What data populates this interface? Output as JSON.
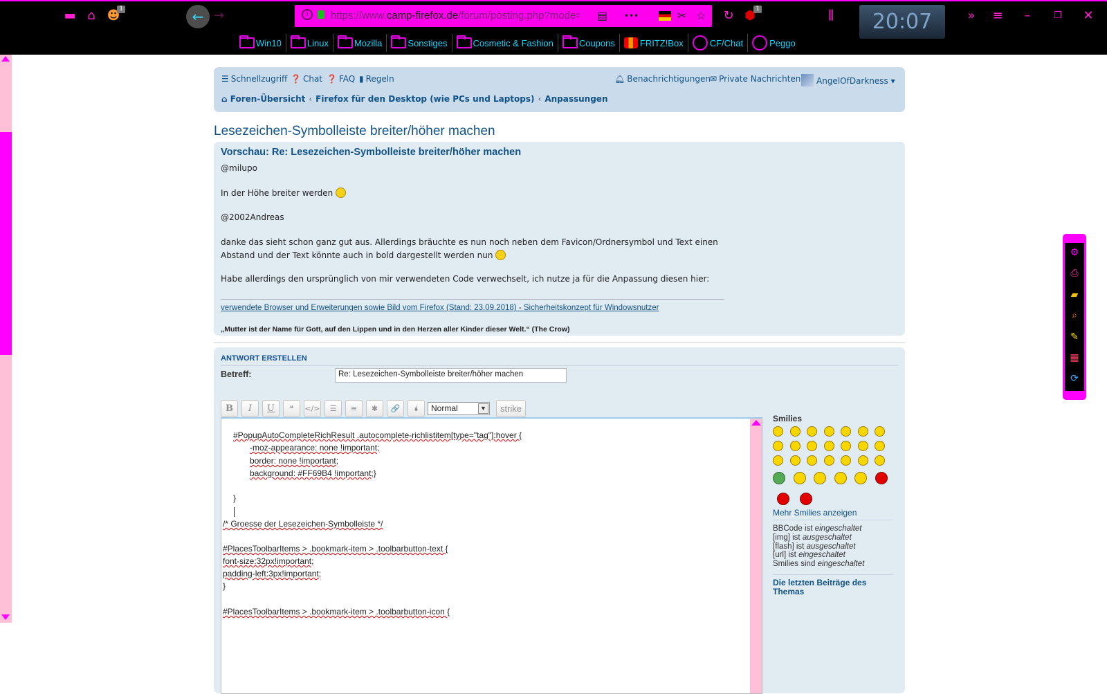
{
  "browser": {
    "url_domain": "camp-firefox.de",
    "url_prefix": "https://www.",
    "url_suffix": "/forum/posting.php?mode=re...",
    "toolbar_badge": "1",
    "ublock_badge": "1",
    "clock": "20:07",
    "icons": {
      "left": [
        "tabs-icon",
        "home-icon",
        "addon-icon"
      ],
      "url": [
        "info-icon",
        "lock-icon",
        "reader-icon",
        "more-icon",
        "flag-de-icon",
        "screenshot-icon",
        "star-icon"
      ],
      "right": [
        "reload-icon",
        "ublock-icon",
        "library-icon",
        "overflow-icon",
        "menu-icon",
        "minimize-icon",
        "restore-icon",
        "close-icon"
      ]
    },
    "bookmarks": [
      {
        "label": "Win10",
        "icon": "folder"
      },
      {
        "label": "Linux",
        "icon": "folder"
      },
      {
        "label": "Mozilla",
        "icon": "folder"
      },
      {
        "label": "Sonstiges",
        "icon": "folder"
      },
      {
        "label": "Cosmetic & Fashion",
        "icon": "folder"
      },
      {
        "label": "Coupons",
        "icon": "folder"
      },
      {
        "label": "FRITZ!Box",
        "icon": "fritz"
      },
      {
        "label": "CF/Chat",
        "icon": "globe"
      },
      {
        "label": "Peggo",
        "icon": "globe"
      }
    ]
  },
  "forum": {
    "nav": {
      "quick": "Schnellzugriff",
      "chat": "Chat",
      "faq": "FAQ",
      "rules": "Regeln",
      "notifications": "Benachrichtigungen",
      "pm": "Private Nachrichten",
      "user": "AngelOfDarkness"
    },
    "crumbs": [
      "Foren-Übersicht",
      "Firefox für den Desktop (wie PCs und Laptops)",
      "Anpassungen"
    ],
    "topic_title": "Lesezeichen-Symbolleiste breiter/höher machen",
    "preview": {
      "title": "Vorschau: Re: Lesezeichen-Symbolleiste breiter/höher machen",
      "lines": [
        "@milupo",
        "In der Höhe breiter werden",
        "@2002Andreas",
        "danke das sieht schon ganz gut aus. Allerdings bräuchte es nun noch neben dem Favicon/Ordnersymbol und Text einen",
        "Abstand und der Text könnte auch in bold dargestellt werden nun",
        "Habe allerdings den ursprünglich von mir verwendeten Code verwechselt, ich nutze ja für die Anpassung diesen hier:"
      ],
      "sig_link1": "verwendete Browser und Erweiterungen sowie Bild vom Firefox (Stand: 23.09.2018)",
      "sig_dash": " - ",
      "sig_link2": "Sicherheitskonzept für Windowsnutzer",
      "quote": "„Mutter ist der Name für Gott, auf den Lippen und in den Herzen aller Kinder dieser Welt.“ (The Crow)"
    },
    "reply": {
      "title": "ANTWORT ERSTELLEN",
      "subject_label": "Betreff:",
      "subject_value": "Re: Lesezeichen-Symbolleiste breiter/höher machen",
      "bb_buttons": [
        "B",
        "I",
        "U",
        "❝",
        "</>",
        "☰",
        "≡",
        "✱",
        "🔗",
        "🌢"
      ],
      "size_select": "Normal",
      "strike": "strike",
      "code_lines": [
        "#PopupAutoCompleteRichResult .autocomplete-richlistitem[type=\"tag\"]:hover {",
        "-moz-appearance: none !important;",
        "border: none !important;",
        "background: #FF69B4 !important;}",
        "}",
        "/* Groesse der Lesezeichen-Symbolleiste */",
        "#PlacesToolbarItems > .bookmark-item > .toolbarbutton-text {",
        "font-size:32px!important;",
        "padding-left:3px!important;",
        "}",
        "#PlacesToolbarItems > .bookmark-item > .toolbarbutton-icon {"
      ]
    },
    "smilies": {
      "title": "Smilies",
      "more": "Mehr Smilies anzeigen",
      "status": [
        {
          "prefix": "BBCode ist ",
          "state": "eingeschaltet"
        },
        {
          "prefix": "[img] ist ",
          "state": "ausgeschaltet"
        },
        {
          "prefix": "[flash] ist ",
          "state": "ausgeschaltet"
        },
        {
          "prefix": "[url] ist ",
          "state": "eingeschaltet"
        },
        {
          "prefix": "Smilies sind ",
          "state": "eingeschaltet"
        }
      ],
      "latest_1": "Die letzten Beiträge des",
      "latest_2": "Themas"
    }
  },
  "side_toolbar": [
    "settings-icon",
    "print-icon",
    "folder-icon",
    "search-icon",
    "note-icon",
    "calendar-icon",
    "sync-icon"
  ]
}
